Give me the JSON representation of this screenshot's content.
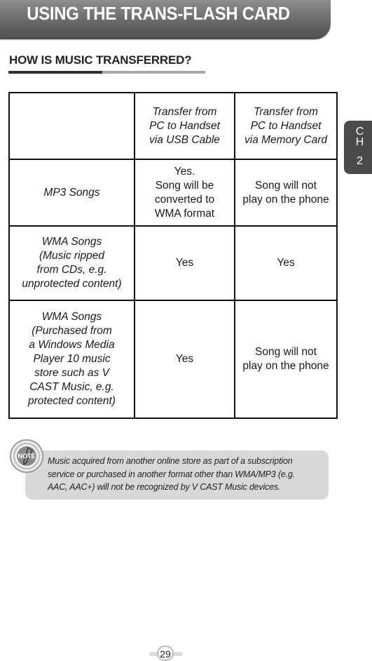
{
  "header": {
    "title": "USING THE TRANS-FLASH CARD"
  },
  "section": {
    "title": "HOW IS MUSIC TRANSFERRED?"
  },
  "chapter_tab": {
    "letters": [
      "C",
      "H"
    ],
    "number": "2"
  },
  "table": {
    "headers": [
      {
        "lines": []
      },
      {
        "lines": [
          "Transfer from",
          "PC to Handset",
          "via USB Cable"
        ]
      },
      {
        "lines": [
          "Transfer from",
          "PC to Handset",
          "via Memory Card"
        ]
      }
    ],
    "rows": [
      {
        "label": [
          "MP3 Songs"
        ],
        "usb": [
          "Yes.",
          "Song will be",
          "converted to",
          "WMA format"
        ],
        "memory_card": [
          "Song will not",
          "play on the phone"
        ]
      },
      {
        "label": [
          "WMA Songs",
          "(Music ripped",
          "from CDs, e.g.",
          "unprotected content)"
        ],
        "usb": [
          "Yes"
        ],
        "memory_card": [
          "Yes"
        ]
      },
      {
        "label": [
          "WMA Songs",
          "(Purchased from",
          "a Windows Media",
          "Player 10 music",
          "store such as V",
          "CAST Music, e.g.",
          "protected content)"
        ],
        "usb": [
          "Yes"
        ],
        "memory_card": [
          "Song will not",
          "play on the phone"
        ]
      }
    ]
  },
  "note": {
    "icon": "note-icon",
    "icon_label": "NOTE",
    "lines": [
      "Music acquired from another online store as part of a subscription",
      "service or purchased in another format other than WMA/MP3 (e.g.",
      "AAC, AAC+) will not be recognized by V CAST Music devices."
    ]
  },
  "page_number": "29"
}
